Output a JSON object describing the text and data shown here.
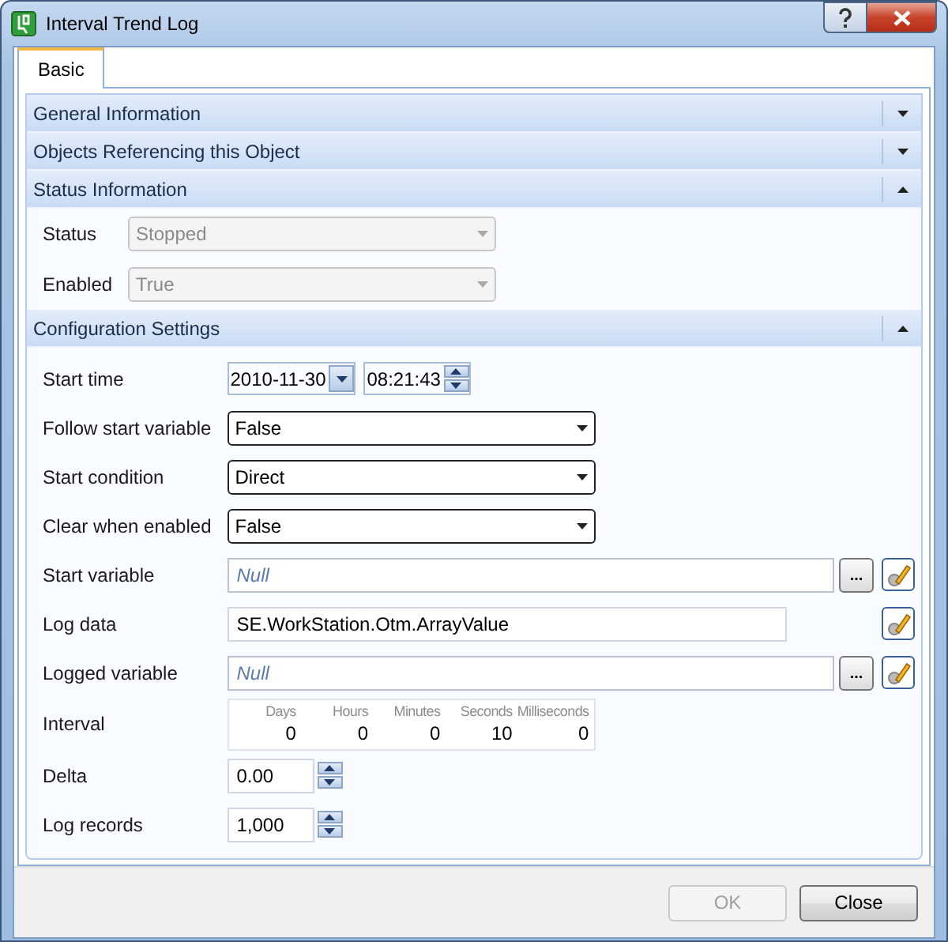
{
  "window": {
    "title": "Interval Trend Log"
  },
  "tabs": [
    {
      "label": "Basic",
      "selected": true
    }
  ],
  "sections": [
    {
      "title": "General Information",
      "expanded": false
    },
    {
      "title": "Objects Referencing this Object",
      "expanded": false
    },
    {
      "title": "Status Information",
      "expanded": true,
      "fields": [
        {
          "kind": "combo",
          "label": "Status",
          "value": "Stopped",
          "disabled": true
        },
        {
          "kind": "combo",
          "label": "Enabled",
          "value": "True",
          "disabled": true
        }
      ]
    },
    {
      "title": "Configuration Settings",
      "expanded": true,
      "fields": [
        {
          "kind": "datetime",
          "label": "Start time",
          "date": "2010-11-30",
          "time": "08:21:43"
        },
        {
          "kind": "combo",
          "label": "Follow start variable",
          "value": "False",
          "disabled": false
        },
        {
          "kind": "combo",
          "label": "Start condition",
          "value": "Direct",
          "disabled": false
        },
        {
          "kind": "combo",
          "label": "Clear when enabled",
          "value": "False",
          "disabled": false
        },
        {
          "kind": "reference",
          "label": "Start variable",
          "placeholder": "Null",
          "browse": "..."
        },
        {
          "kind": "reference",
          "label": "Log data",
          "value": "SE.WorkStation.Otm.ArrayValue"
        },
        {
          "kind": "reference",
          "label": "Logged variable",
          "placeholder": "Null",
          "browse": "..."
        },
        {
          "kind": "interval",
          "label": "Interval",
          "units": [
            {
              "label": "Days",
              "value": "0"
            },
            {
              "label": "Hours",
              "value": "0"
            },
            {
              "label": "Minutes",
              "value": "0"
            },
            {
              "label": "Seconds",
              "value": "10"
            },
            {
              "label": "Milliseconds",
              "value": "0"
            }
          ]
        },
        {
          "kind": "spinner",
          "label": "Delta",
          "value": "0.00"
        },
        {
          "kind": "spinner",
          "label": "Log records",
          "value": "1,000"
        }
      ]
    }
  ],
  "buttons": [
    {
      "label": "OK",
      "disabled": true
    },
    {
      "label": "Close",
      "disabled": false
    }
  ]
}
